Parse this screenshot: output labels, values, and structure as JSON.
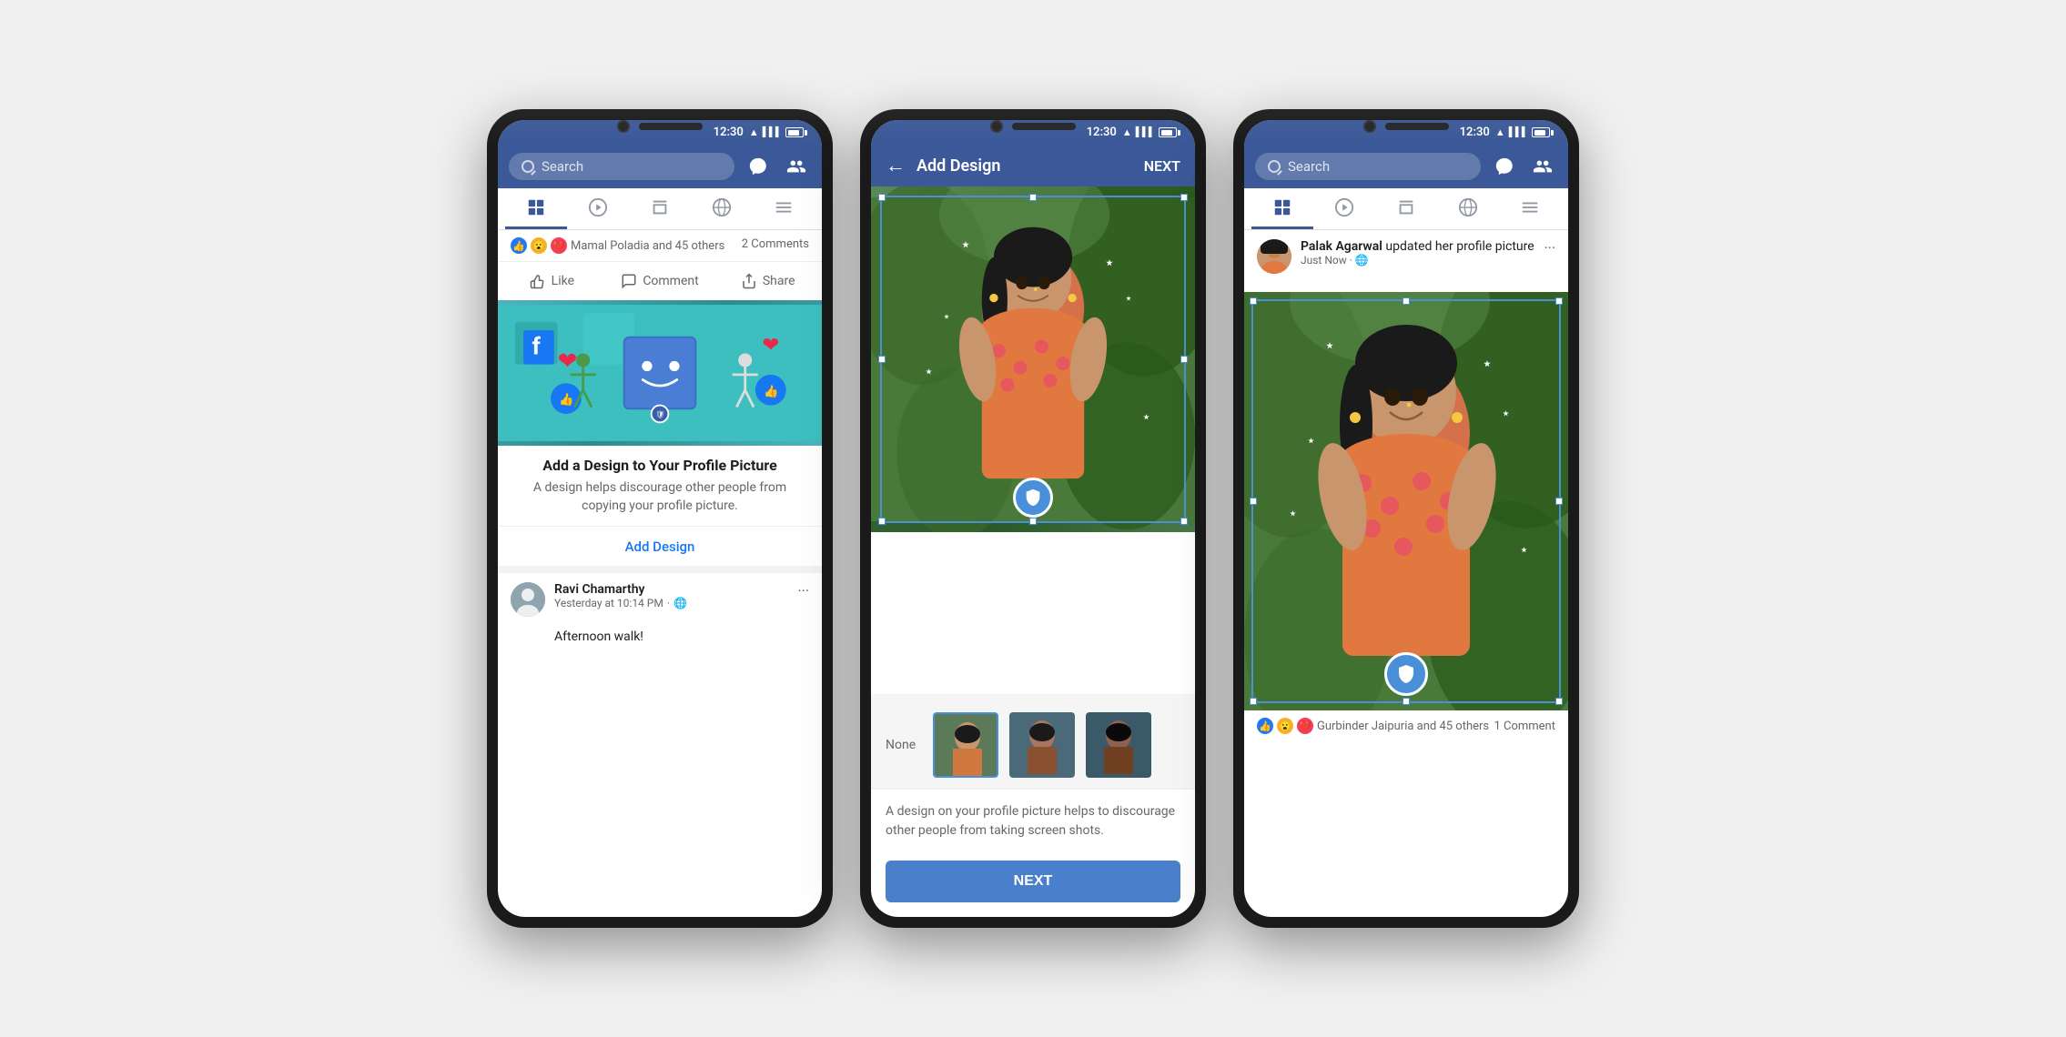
{
  "phones": [
    {
      "id": "phone1",
      "type": "newsfeed",
      "statusBar": {
        "time": "12:30"
      },
      "header": {
        "searchPlaceholder": "Search",
        "icons": [
          "messenger",
          "people"
        ]
      },
      "navTabs": [
        "newsfeed",
        "video",
        "marketplace",
        "globe",
        "menu"
      ],
      "activeTab": 0,
      "post": {
        "reactions": {
          "icons": [
            "👍",
            "😮",
            "❤️"
          ],
          "text": "Mamal Poladia and 45 others",
          "comments": "2 Comments"
        },
        "actions": [
          "Like",
          "Comment",
          "Share"
        ]
      },
      "promoCard": {
        "title": "Add a Design to Your Profile Picture",
        "description": "A design helps discourage other people from copying your profile picture.",
        "ctaLink": "Add Design"
      },
      "miniPost": {
        "author": "Ravi Chamarthy",
        "time": "Yesterday at 10:14 PM",
        "privacy": "🌐",
        "content": "Afternoon walk!"
      }
    },
    {
      "id": "phone2",
      "type": "addDesign",
      "statusBar": {
        "time": "12:30"
      },
      "header": {
        "backLabel": "←",
        "title": "Add Design",
        "nextLabel": "NEXT"
      },
      "filters": {
        "noneLabel": "None",
        "options": [
          "none",
          "filter1",
          "filter2"
        ]
      },
      "promoText": "A design on your profile picture helps to discourage other people from taking screen shots.",
      "nextButton": "NEXT"
    },
    {
      "id": "phone3",
      "type": "updatedProfile",
      "statusBar": {
        "time": "12:30"
      },
      "header": {
        "searchPlaceholder": "Search",
        "icons": [
          "messenger",
          "people"
        ]
      },
      "navTabs": [
        "newsfeed",
        "video",
        "marketplace",
        "globe",
        "menu"
      ],
      "activeTab": 0,
      "updatePost": {
        "author": "Palak Agarwal",
        "action": "updated her profile picture",
        "time": "Just Now",
        "privacy": "🌐"
      },
      "bottomReactions": {
        "icons": [
          "👍",
          "😮",
          "❤️"
        ],
        "text": "Gurbinder Jaipuria and 45 others",
        "comments": "1 Comment"
      }
    }
  ]
}
